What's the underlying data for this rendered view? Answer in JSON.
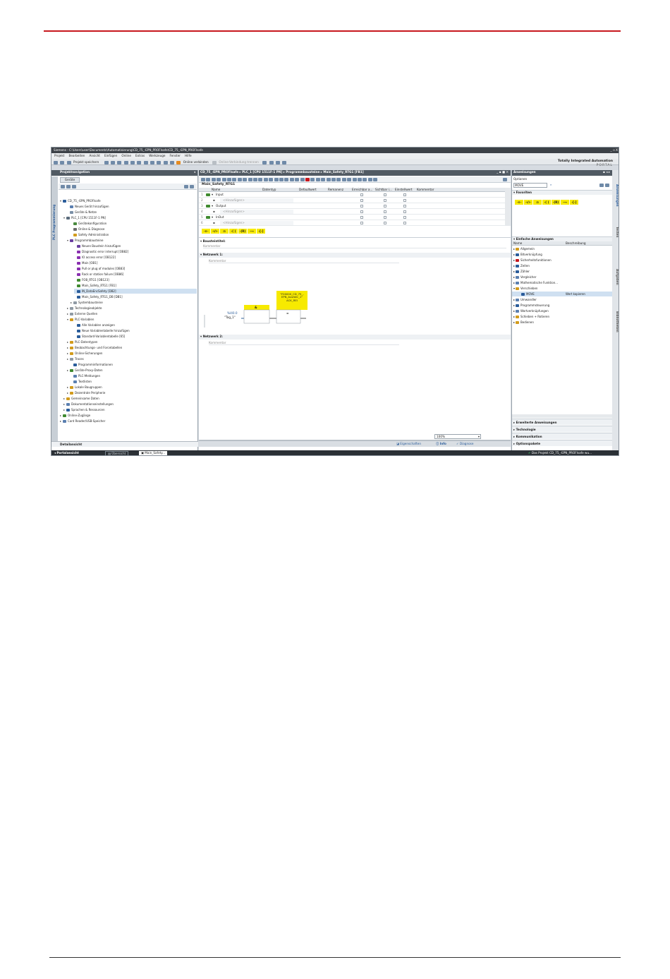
{
  "window": {
    "title": "Siemens - C:\\Users\\user\\Documents\\Automatisierung\\CD_75_-EPN_PROFIsafe\\CD_75_-EPN_PROFIsafe",
    "controls": "_ ▫ X"
  },
  "menu": [
    "Projekt",
    "Bearbeiten",
    "Ansicht",
    "Einfügen",
    "Online",
    "Extras",
    "Werkzeuge",
    "Fenster",
    "Hilfe"
  ],
  "toolbar": {
    "save_label": "Projekt speichern",
    "online_connect": "Online verbinden",
    "online_disconnect": "Online-Verbindung trennen"
  },
  "brand": {
    "line1": "Totally Integrated Automation",
    "line2": "PORTAL"
  },
  "project_nav": {
    "header": "Projektnavigation",
    "tab": "Geräte",
    "vertical_label": "PLC Programmierung",
    "items": [
      {
        "label": "CD_75_-EPN_PROFIsafe",
        "indent": 0
      },
      {
        "label": "Neues Gerät hinzufügen",
        "indent": 2
      },
      {
        "label": "Geräte & Netze",
        "indent": 2
      },
      {
        "label": "PLC_1 [CPU 1511F-1 PN]",
        "indent": 1
      },
      {
        "label": "Gerätekonfiguration",
        "indent": 3
      },
      {
        "label": "Online & Diagnose",
        "indent": 3
      },
      {
        "label": "Safety Administration",
        "indent": 3
      },
      {
        "label": "Programmbausteine",
        "indent": 2
      },
      {
        "label": "Neuen Baustein hinzufügen",
        "indent": 4
      },
      {
        "label": "Diagnostic error interrupt [OB82]",
        "indent": 4
      },
      {
        "label": "IO access error [OB122]",
        "indent": 4
      },
      {
        "label": "Main [OB1]",
        "indent": 4
      },
      {
        "label": "Pull or plug of modules [OB83]",
        "indent": 4
      },
      {
        "label": "Rack or station failure [OB86]",
        "indent": 4
      },
      {
        "label": "FOB_RTG1 [OB123]",
        "indent": 4
      },
      {
        "label": "Main_Safety_RTG1 [FB1]",
        "indent": 4
      },
      {
        "label": "IN_DataEncSafety [DB2]",
        "indent": 4
      },
      {
        "label": "Main_Safety_RTG1_DB [DB1]",
        "indent": 4
      },
      {
        "label": "Systembausteine",
        "indent": 3
      },
      {
        "label": "Technologieobjekte",
        "indent": 2
      },
      {
        "label": "Externe Quellen",
        "indent": 2
      },
      {
        "label": "PLC-Variablen",
        "indent": 2
      },
      {
        "label": "Alle Variablen anzeigen",
        "indent": 4
      },
      {
        "label": "Neue Variablentabelle hinzufügen",
        "indent": 4
      },
      {
        "label": "Standard-Variablentabelle [65]",
        "indent": 4
      },
      {
        "label": "PLC-Datentypen",
        "indent": 2
      },
      {
        "label": "Beobachtungs- und Forcetabellen",
        "indent": 2
      },
      {
        "label": "Online-Sicherungen",
        "indent": 2
      },
      {
        "label": "Traces",
        "indent": 2
      },
      {
        "label": "Programminformationen",
        "indent": 3
      },
      {
        "label": "Geräte-Proxy-Daten",
        "indent": 2
      },
      {
        "label": "PLC-Meldungen",
        "indent": 3
      },
      {
        "label": "Textlisten",
        "indent": 3
      },
      {
        "label": "Lokale Baugruppen",
        "indent": 2
      },
      {
        "label": "Dezentrale Peripherie",
        "indent": 2
      },
      {
        "label": "Gemeinsame Daten",
        "indent": 1
      },
      {
        "label": "Dokumentationseinstellungen",
        "indent": 1
      },
      {
        "label": "Sprachen & Ressourcen",
        "indent": 1
      },
      {
        "label": "Online-Zugänge",
        "indent": 0
      },
      {
        "label": "Card Reader/USB-Speicher",
        "indent": 0
      }
    ],
    "detail_view": "Detailansicht",
    "portal_view": "Portalansicht",
    "overview_tab": "Übersicht",
    "main_safety_tab": "Main_Safety..."
  },
  "editor": {
    "breadcrumb": "CD_75_-EPN_PROFIsafe  ▸  PLC_1 [CPU 1511F-1 PN]  ▸  Programmbausteine  ▸  Main_Safety_RTG1 [FB1]",
    "block_name": "Main_Safety_RTG1",
    "columns": [
      "Name",
      "Datentyp",
      "Defaultwert",
      "Remanenz",
      "Erreichbar a...",
      "Sichtbar i...",
      "Einstellwert",
      "Kommentar"
    ],
    "rows": [
      {
        "num": "1",
        "name": "Input"
      },
      {
        "num": "2",
        "name": "<Hinzufügen>"
      },
      {
        "num": "3",
        "name": "Output"
      },
      {
        "num": "4",
        "name": "<Hinzufügen>"
      },
      {
        "num": "5",
        "name": "InOut"
      },
      {
        "num": "6",
        "name": "<Hinzufügen>"
      }
    ],
    "ladder_buttons": [
      "⊣⊢",
      "⊣/⊢",
      "⊡",
      "-( )",
      "-(R)",
      "⟶",
      "-[-]"
    ],
    "block_title_label": "Bausteintitel:",
    "block_comment": "Kommentar",
    "network1_label": "Netzwerk 1:",
    "network1_comment": "Kommentar",
    "network2_label": "Netzwerk 2:",
    "network2_comment": "Kommentar",
    "contact_addr": "%I40.0",
    "contact_tag": "\"Tag_1\"",
    "box_top_label": "\"F00000_CD_75_-EPN_Ausfahr_1\" ACK_REI",
    "box1_label": "&",
    "box2_label": "=",
    "zoom": "100%",
    "props_tab": "Eigenschaften",
    "info_tab": "Info",
    "diag_tab": "Diagnose"
  },
  "instructions": {
    "header": "Anweisungen",
    "options": "Optionen",
    "search_value": "MOVE",
    "favorites": "Favoriten",
    "fav_buttons": [
      "⊣⊢",
      "⊣/⊢",
      "⊡",
      "-( )",
      "-(R)",
      "⟶",
      "-[-]"
    ],
    "simple_title": "Einfache Anweisungen",
    "col_name": "Name",
    "col_desc": "Beschreibung",
    "items": [
      {
        "label": "Allgemein",
        "desc": ""
      },
      {
        "label": "Bitverknüpfung",
        "desc": ""
      },
      {
        "label": "Sicherheitsfunktionen",
        "desc": ""
      },
      {
        "label": "Zeiten",
        "desc": ""
      },
      {
        "label": "Zähler",
        "desc": ""
      },
      {
        "label": "Vergleicher",
        "desc": ""
      },
      {
        "label": "Mathematische Funktion...",
        "desc": ""
      },
      {
        "label": "Verschieben",
        "desc": ""
      },
      {
        "label": "MOVE",
        "desc": "Wert kopieren"
      },
      {
        "label": "Umwandler",
        "desc": ""
      },
      {
        "label": "Programmsteuerung",
        "desc": ""
      },
      {
        "label": "Wortverknüpfungen",
        "desc": ""
      },
      {
        "label": "Schieben + Rotieren",
        "desc": ""
      },
      {
        "label": "Bedienen",
        "desc": ""
      }
    ],
    "sections": [
      "Erweiterte Anweisungen",
      "Technologie",
      "Kommunikation",
      "Optionspakete"
    ]
  },
  "side_tabs": [
    "Anweisungen",
    "Testen",
    "Aufgaben",
    "Bibliotheken"
  ],
  "status": {
    "message": "Das Projekt CD_75_-EPN_PROFIsafe wu..."
  }
}
